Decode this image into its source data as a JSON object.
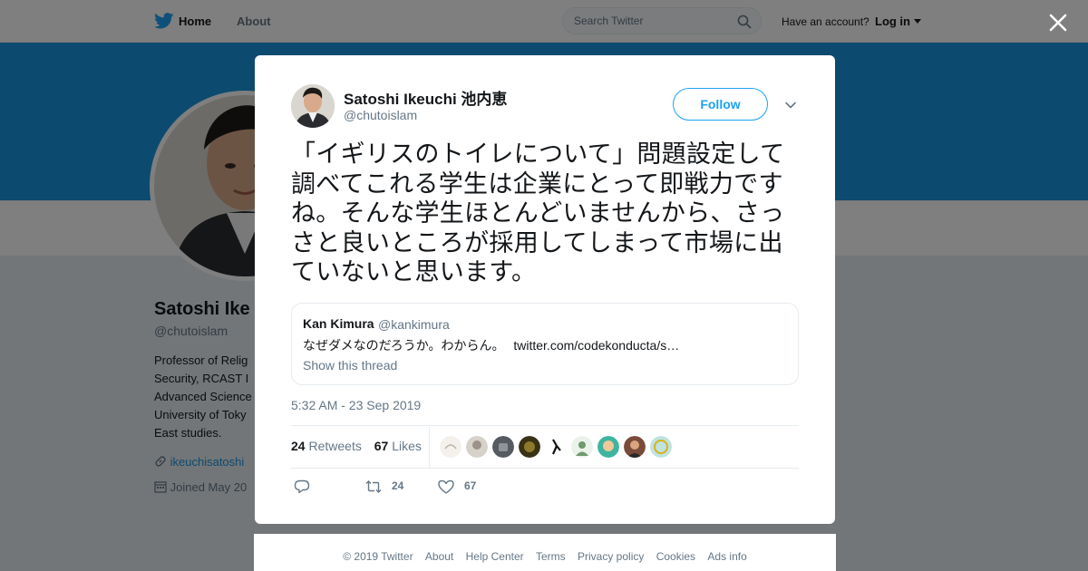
{
  "nav": {
    "home_label": "Home",
    "about_label": "About",
    "search_placeholder": "Search Twitter",
    "have_account": "Have an account?",
    "login_label": "Log in"
  },
  "profile": {
    "name": "Satoshi Ike",
    "handle": "@chutoislam",
    "bio_lines": [
      "Professor of Relig",
      "Security, RCAST I",
      "Advanced Science",
      "University of Toky",
      "East studies."
    ],
    "link": "ikeuchisatoshi",
    "joined": "Joined May 20"
  },
  "tweet": {
    "author_name": "Satoshi Ikeuchi 池内恵",
    "author_handle": "@chutoislam",
    "follow_label": "Follow",
    "text": "「イギリスのトイレについて」問題設定して調べてこれる学生は企業にとって即戦力ですね。そんな学生ほとんどいませんから、さっさと良いところが採用してしまって市場に出ていないと思います。",
    "quote": {
      "name": "Kan Kimura",
      "handle": "@kankimura",
      "text": "なぜダメなのだろうか。わからん。",
      "link": "twitter.com/codekonducta/s…",
      "show_thread": "Show this thread"
    },
    "timestamp": "5:32 AM - 23 Sep 2019",
    "retweets_count": "24",
    "retweets_label": "Retweets",
    "likes_count": "67",
    "likes_label": "Likes",
    "actions": {
      "retweet_count": "24",
      "like_count": "67"
    }
  },
  "footer": {
    "links": [
      "© 2019 Twitter",
      "About",
      "Help Center",
      "Terms",
      "Privacy policy",
      "Cookies",
      "Ads info"
    ]
  },
  "colors": {
    "brand": "#1da1f2",
    "banner": "#1b95e0",
    "muted": "#657786",
    "text": "#14171a"
  }
}
